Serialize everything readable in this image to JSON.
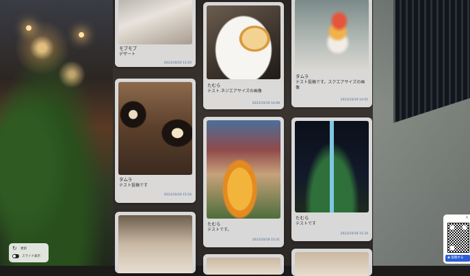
{
  "posts": [
    {
      "author": "モブモブ",
      "text": "デザート",
      "date": "2023/10/20 11:03"
    },
    {
      "author": "たむら",
      "text": "テスト.ネジエアサイズの画像",
      "date": "2023/10/19 14:08"
    },
    {
      "author": "タムラ",
      "text": "テスト投稿です。スクエアサイズの画像",
      "date": "2023/10/19 14:05"
    },
    {
      "author": "タムラ",
      "text": "テスト投稿です",
      "date": "2023/10/19 15:54"
    },
    {
      "author": "たむら",
      "text": "テストです。",
      "date": "2023/10/18 15:41"
    },
    {
      "author": "たむら",
      "text": "テストです",
      "date": "2023/10/18 15:34"
    }
  ],
  "controls": {
    "refresh_label": "更新",
    "autoplay_label": "スライド表示"
  },
  "qr": {
    "close": "×",
    "button_label": "投稿する"
  },
  "icons": {
    "refresh": "refresh-icon",
    "close": "close-icon",
    "qr": "qr-code"
  }
}
